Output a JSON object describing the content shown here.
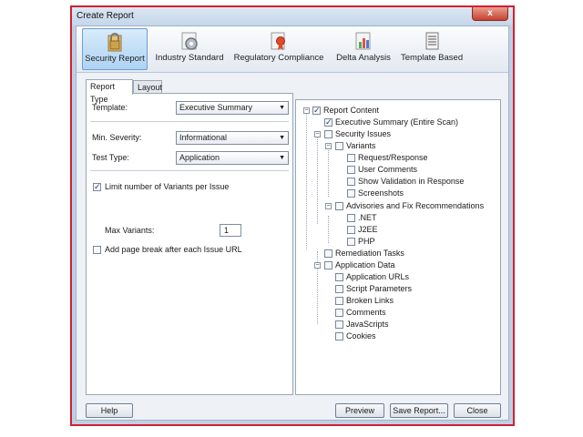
{
  "window": {
    "title": "Create Report",
    "close_glyph": "x"
  },
  "toolbar": {
    "items": [
      {
        "label": "Security Report",
        "icon": "lock-icon",
        "active": true
      },
      {
        "label": "Industry Standard",
        "icon": "gear-icon",
        "active": false
      },
      {
        "label": "Regulatory Compliance",
        "icon": "certificate-icon",
        "active": false
      },
      {
        "label": "Delta Analysis",
        "icon": "bar-chart-icon",
        "active": false
      },
      {
        "label": "Template Based",
        "icon": "document-icon",
        "active": false
      }
    ]
  },
  "tabs": [
    {
      "label": "Report Type",
      "selected": true
    },
    {
      "label": "Layout",
      "selected": false
    }
  ],
  "form": {
    "template_label": "Template:",
    "template_value": "Executive Summary",
    "severity_label": "Min. Severity:",
    "severity_value": "Informational",
    "test_type_label": "Test Type:",
    "test_type_value": "Application",
    "limit_label": "Limit number of Variants per Issue",
    "limit_checked": true,
    "max_variants_label": "Max Variants:",
    "max_variants_value": "1",
    "page_break_label": "Add page break after each Issue URL",
    "page_break_checked": false
  },
  "tree": {
    "report_content": "Report Content",
    "executive_summary": "Executive Summary (Entire Scan)",
    "security_issues": "Security Issues",
    "variants": "Variants",
    "request_response": "Request/Response",
    "user_comments": "User Comments",
    "show_validation": "Show Validation in Response",
    "screenshots": "Screenshots",
    "advisories": "Advisories and Fix Recommendations",
    "net": ".NET",
    "j2ee": "J2EE",
    "php": "PHP",
    "remediation_tasks": "Remediation Tasks",
    "application_data": "Application Data",
    "application_urls": "Application URLs",
    "script_parameters": "Script Parameters",
    "broken_links": "Broken Links",
    "comments": "Comments",
    "javascripts": "JavaScripts",
    "cookies": "Cookies"
  },
  "buttons": {
    "help": "Help",
    "preview": "Preview",
    "save_report": "Save Report...",
    "close": "Close"
  },
  "colors": {
    "frame_border": "#d22030",
    "active_tab_bg": "#aed3f3"
  }
}
